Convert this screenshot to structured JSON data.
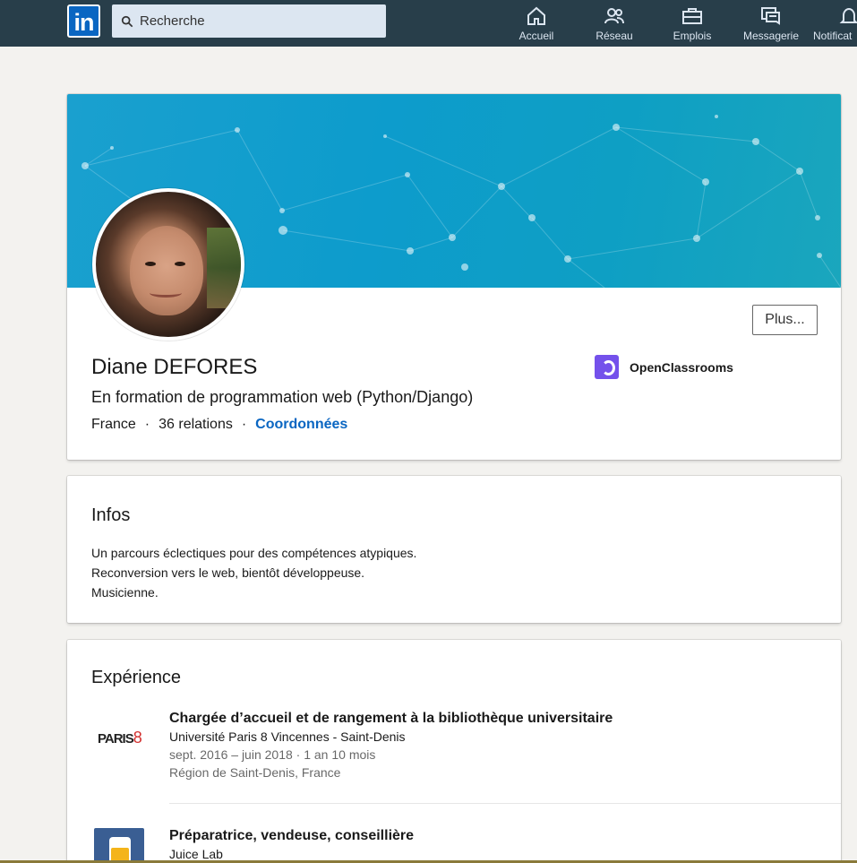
{
  "nav": {
    "search_placeholder": "Recherche",
    "items": [
      {
        "label": "Accueil",
        "icon": "home-icon"
      },
      {
        "label": "Réseau",
        "icon": "network-icon"
      },
      {
        "label": "Emplois",
        "icon": "briefcase-icon"
      },
      {
        "label": "Messagerie",
        "icon": "messaging-icon"
      },
      {
        "label": "Notificat",
        "icon": "bell-icon"
      }
    ],
    "logo_text": "in"
  },
  "profile": {
    "name": "Diane DEFORES",
    "headline": "En formation de programmation web (Python/Django)",
    "location": "France",
    "connections": "36 relations",
    "contact_link": "Coordonnées",
    "more_button": "Plus...",
    "school": "OpenClassrooms"
  },
  "infos": {
    "title": "Infos",
    "lines": [
      "Un parcours éclectiques pour des compétences atypiques.",
      "Reconversion vers le web, bientôt développeuse.",
      "Musicienne."
    ]
  },
  "experience": {
    "title": "Expérience",
    "items": [
      {
        "logo_text": "PARIS",
        "logo_number": "8",
        "title": "Chargée d’accueil et de rangement à la bibliothèque universitaire",
        "company": "Université Paris 8 Vincennes - Saint-Denis",
        "dates": "sept. 2016 – juin 2018 · 1 an 10 mois",
        "location": "Région de Saint-Denis, France"
      },
      {
        "title": "Préparatrice, vendeuse, conseillière",
        "company": "Juice Lab"
      }
    ]
  },
  "colors": {
    "nav_bg": "#283e4a",
    "accent": "#0a66c2",
    "school_logo": "#7451eb"
  }
}
